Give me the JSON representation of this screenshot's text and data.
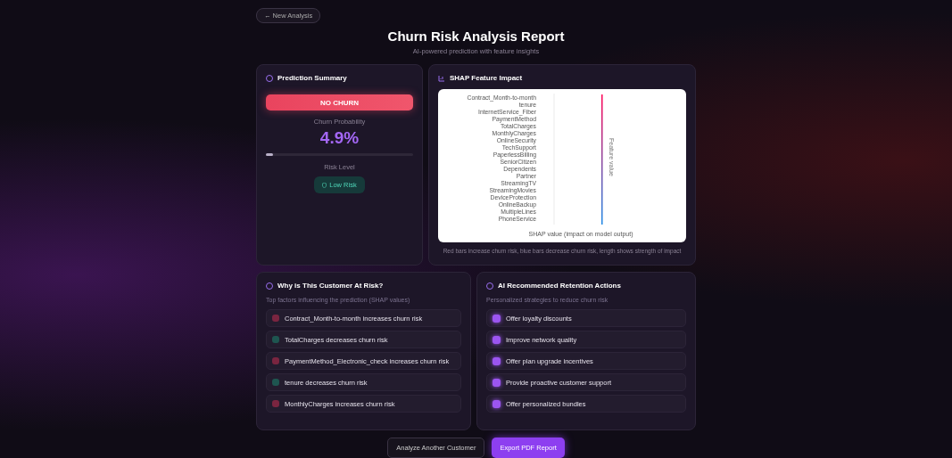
{
  "back_button": {
    "label": "← New Analysis"
  },
  "header": {
    "title": "Churn Risk Analysis Report",
    "subtitle": "AI-powered prediction with feature insights"
  },
  "prediction": {
    "title": "Prediction Summary",
    "verdict": "NO CHURN",
    "probability_label": "Churn Probability",
    "probability": "4.9%",
    "level": 0.049,
    "risk_label": "Risk Level",
    "risk_badge": {
      "label": "Low Risk",
      "kind": "low"
    }
  },
  "shap": {
    "title": "SHAP Feature Impact",
    "features": [
      "Contract_Month-to-month",
      "tenure",
      "InternetService_Fiber",
      "PaymentMethod",
      "TotalCharges",
      "MonthlyCharges",
      "OnlineSecurity",
      "TechSupport",
      "PaperlessBilling",
      "SeniorCitizen",
      "Dependents",
      "Partner",
      "StreamingTV",
      "StreamingMovies",
      "DeviceProtection",
      "OnlineBackup",
      "MultipleLines",
      "PhoneService"
    ],
    "xlabel": "SHAP value (impact on model output)",
    "side_label": "Feature value",
    "caption": "Red bars increase churn risk, blue bars decrease churn risk, length shows strength of impact"
  },
  "reasons": {
    "title": "Why is This Customer At Risk?",
    "subtitle": "Top factors influencing the prediction (SHAP values)",
    "items": [
      {
        "text": "Contract_Month-to-month increases churn risk",
        "kind": "increase"
      },
      {
        "text": "TotalCharges decreases churn risk",
        "kind": "decrease"
      },
      {
        "text": "PaymentMethod_Electronic_check increases churn risk",
        "kind": "increase"
      },
      {
        "text": "tenure decreases churn risk",
        "kind": "decrease"
      },
      {
        "text": "MonthlyCharges increases churn risk",
        "kind": "increase"
      }
    ]
  },
  "actions": {
    "title": "AI Recommended Retention Actions",
    "subtitle": "Personalized strategies to reduce churn risk",
    "items": [
      "Offer loyalty discounts",
      "Improve network quality",
      "Offer plan upgrade incentives",
      "Provide proactive customer support",
      "Offer personalized bundles"
    ]
  },
  "buttons": [
    {
      "label": "Analyze Another Customer",
      "kind": "secondary"
    },
    {
      "label": "Export PDF Report",
      "kind": "primary"
    }
  ]
}
